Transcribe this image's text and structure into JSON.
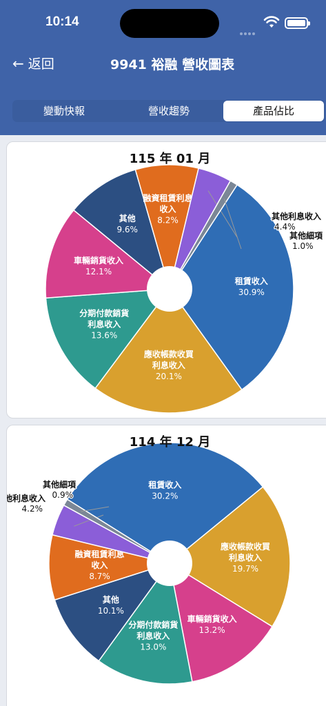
{
  "status_bar": {
    "time": "10:14"
  },
  "nav": {
    "back_label": "返回",
    "title": "9941 裕融 營收圖表"
  },
  "tabs": [
    {
      "label": "變動快報",
      "active": false
    },
    {
      "label": "營收趨勢",
      "active": false
    },
    {
      "label": "產品佔比",
      "active": true
    }
  ],
  "chart_data": [
    {
      "type": "pie",
      "title": "115 年 01 月",
      "slices": [
        {
          "label": "租賃收入",
          "value": 30.9,
          "display": "30.9%",
          "color": "#2f6db5"
        },
        {
          "label": "應收帳款收買利息收入",
          "value": 20.1,
          "display": "20.1%",
          "color": "#d9a02e"
        },
        {
          "label": "分期付款銷貨利息收入",
          "value": 13.6,
          "display": "13.6%",
          "color": "#2e9a8f"
        },
        {
          "label": "車輛銷貨收入",
          "value": 12.1,
          "display": "12.1%",
          "color": "#d6408c"
        },
        {
          "label": "其他",
          "value": 9.6,
          "display": "9.6%",
          "color": "#2c4f82"
        },
        {
          "label": "融資租賃利息收入",
          "value": 8.2,
          "display": "8.2%",
          "color": "#e06c1e"
        },
        {
          "label": "其他利息收入",
          "value": 4.4,
          "display": "4.4%",
          "color": "#8b5ed8"
        },
        {
          "label": "其他細項",
          "value": 1.0,
          "display": "1.0%",
          "color": "#7b8796"
        }
      ]
    },
    {
      "type": "pie",
      "title": "114 年 12 月",
      "slices": [
        {
          "label": "租賃收入",
          "value": 30.2,
          "display": "30.2%",
          "color": "#2f6db5"
        },
        {
          "label": "應收帳款收買利息收入",
          "value": 19.7,
          "display": "19.7%",
          "color": "#d9a02e"
        },
        {
          "label": "車輛銷貨收入",
          "value": 13.2,
          "display": "13.2%",
          "color": "#d6408c"
        },
        {
          "label": "分期付款銷貨利息收入",
          "value": 13.0,
          "display": "13.0%",
          "color": "#2e9a8f"
        },
        {
          "label": "其他",
          "value": 10.1,
          "display": "10.1%",
          "color": "#2c4f82"
        },
        {
          "label": "融資租賃利息收入",
          "value": 8.7,
          "display": "8.7%",
          "color": "#e06c1e"
        },
        {
          "label": "其他利息收入",
          "value": 4.2,
          "display": "4.2%",
          "color": "#8b5ed8"
        },
        {
          "label": "其他細項",
          "value": 0.9,
          "display": "0.9%",
          "color": "#7b8796"
        }
      ]
    }
  ]
}
